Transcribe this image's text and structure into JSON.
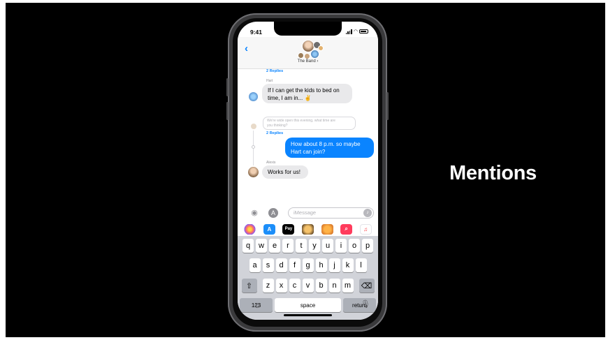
{
  "slide": {
    "title": "Mentions"
  },
  "status_bar": {
    "time": "9:41"
  },
  "header": {
    "back_glyph": "‹",
    "group_name": "The Band ›"
  },
  "messages": {
    "replies_top": "2 Replies",
    "sender_hart": "Hart",
    "hart_line1": "If I can get the kids to bed on",
    "hart_line2": "time, I am in... ✌",
    "faded_line1": "We're wide open this evening, what time are",
    "faded_line2": "you thinking?",
    "replies_mid": "2 Replies",
    "out_line1": "How about 8 p.m. so maybe",
    "out_line2": "Hart can join?",
    "sender_alexis": "Alexis",
    "alexis_text": "Works for us!"
  },
  "input": {
    "placeholder": "iMessage",
    "camera_icon": "camera-icon",
    "apps_icon": "app-store-icon"
  },
  "app_strip": [
    "Photos",
    "App Store",
    "Apple Pay",
    "Memoji",
    "Animoji",
    "Images",
    "Music"
  ],
  "app_labels": {
    "applepay": "Pay"
  },
  "keyboard": {
    "row1": [
      "q",
      "w",
      "e",
      "r",
      "t",
      "y",
      "u",
      "i",
      "o",
      "p"
    ],
    "row2": [
      "a",
      "s",
      "d",
      "f",
      "g",
      "h",
      "j",
      "k",
      "l"
    ],
    "row3": [
      "z",
      "x",
      "c",
      "v",
      "b",
      "n",
      "m"
    ],
    "shift": "⇧",
    "delete": "⌫",
    "numbers": "123",
    "space": "space",
    "return": "return"
  },
  "colors": {
    "accent": "#0a84ff",
    "slide_bg": "#000000"
  }
}
